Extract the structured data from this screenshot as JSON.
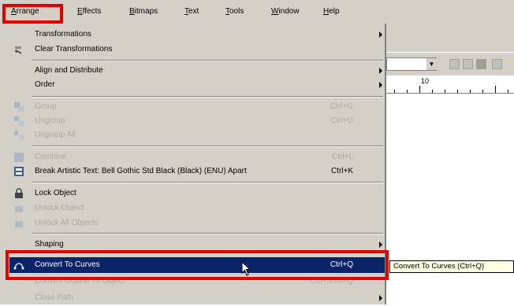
{
  "menubar": {
    "items": [
      "Arrange",
      "Effects",
      "Bitmaps",
      "Text",
      "Tools",
      "Window",
      "Help"
    ]
  },
  "menu": {
    "transformations": "Transformations",
    "clear_transformations": "Clear Transformations",
    "align_distribute": "Align and Distribute",
    "order": "Order",
    "group": "Group",
    "group_sc": "Ctrl+G",
    "ungroup": "Ungroup",
    "ungroup_sc": "Ctrl+U",
    "ungroup_all": "Ungroup All",
    "combine": "Combine",
    "combine_sc": "Ctrl+L",
    "break_apart": "Break Artistic Text: Bell Gothic Std Black (Black) (ENU) Apart",
    "break_apart_sc": "Ctrl+K",
    "lock_object": "Lock Object",
    "unlock_object": "Unlock Object",
    "unlock_all": "Unlock All Objects",
    "shaping": "Shaping",
    "convert_to_curves": "Convert To Curves",
    "convert_to_curves_sc": "Ctrl+Q",
    "convert_outline": "Convert Outline To Object",
    "convert_outline_sc": "Ctrl+Shift+Q",
    "close_path": "Close Path"
  },
  "tooltip": "Convert To Curves (Ctrl+Q)",
  "ruler": {
    "label": "10"
  },
  "colors": {
    "highlight": "#0a246a",
    "annotation": "#e60000",
    "menu_bg": "#d4d0c8"
  }
}
